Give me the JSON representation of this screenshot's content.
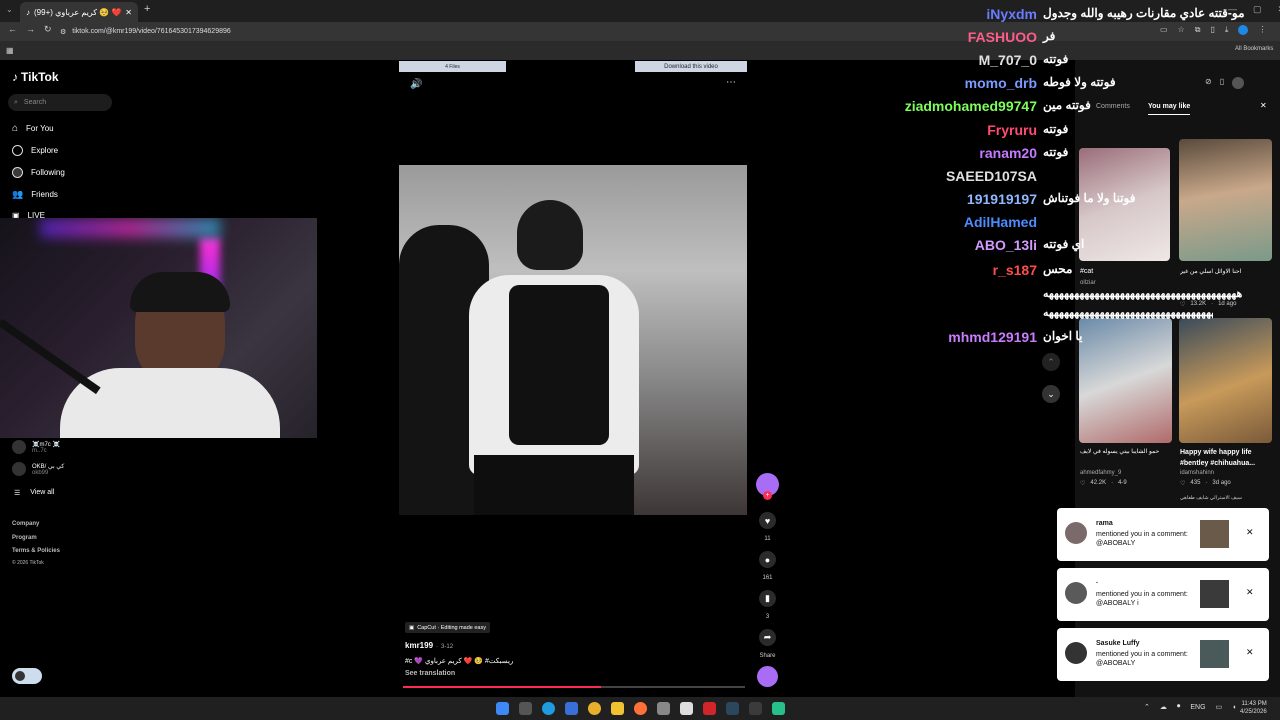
{
  "browser": {
    "tab_title": "(99+) كريم عرباوي 🥺 ❤️ R...",
    "url": "tiktok.com/@kmr199/video/7616453017394629896",
    "bookmarks_label": "All Bookmarks"
  },
  "sidebar": {
    "logo": "TikTok",
    "search_placeholder": "Search",
    "items": [
      {
        "label": "For You"
      },
      {
        "label": "Explore"
      },
      {
        "label": "Following"
      },
      {
        "label": "Friends"
      },
      {
        "label": "LIVE"
      }
    ],
    "accounts": [
      {
        "name": "☠️m7c ☠️",
        "handle": "m..7c"
      },
      {
        "name": "OKB/ كي بي",
        "handle": "okb99"
      }
    ],
    "view_all": "View all",
    "footer": [
      "Company",
      "Program",
      "Terms & Policies",
      "© 2026 TikTok"
    ]
  },
  "player": {
    "overlay_left": "4 Files",
    "overlay_right": "Download this video",
    "capcut": "CapCut · Editing made easy",
    "author": "kmr199",
    "date": "3-12",
    "caption": "#c 💜 ريسبكت# 🥺 ❤️ كريم عرباوي",
    "see_translation": "See translation",
    "likes": "11",
    "comments": "161",
    "saves": "3",
    "share": "Share",
    "progress": 0.58
  },
  "chat": [
    {
      "name": "iNyxdm",
      "msg": "مو-قتته عادي مقارنات رهيبه والله وجدول",
      "color": "#6a7cff"
    },
    {
      "name": "FASHUOO",
      "msg": "فر",
      "color": "#ff5c8a"
    },
    {
      "name": "M_707_0",
      "msg": "فوتته",
      "color": "#e0e0e0"
    },
    {
      "name": "momo_drb",
      "msg": "فوتته ولا فوطه",
      "color": "#7a9cff"
    },
    {
      "name": "ziadmohamed99747",
      "msg": "فوتته مين",
      "color": "#7dff5a"
    },
    {
      "name": "Fryruru",
      "msg": "فوتته",
      "color": "#ff4d6d"
    },
    {
      "name": "ranam20",
      "msg": "فوتته",
      "color": "#c67bff"
    },
    {
      "name": "SAEED107SA",
      "msg": "",
      "color": "#e0e0e0"
    },
    {
      "name": "191919197",
      "msg": "فوتنا ولا ما فوتناش",
      "color": "#8fb8ff"
    },
    {
      "name": "AdilHamed",
      "msg": "",
      "color": "#4d8cff"
    },
    {
      "name": "ABO_13li",
      "msg": "اي فوتته",
      "color": "#d49aff"
    },
    {
      "name": "r_s187",
      "msg": "محس",
      "color": "#ff4d4d"
    },
    {
      "name": "mhmd129191",
      "msg": "يا اخوان",
      "color": "#c87cff"
    }
  ],
  "chat_spam": "ههههههههههههههههههههههههههههههههههههههه",
  "right_panel": {
    "tabs": [
      "Comments",
      "You may like"
    ],
    "cards": [
      {
        "title": "#cat",
        "author": "ollziar",
        "likes": "",
        "date": ""
      },
      {
        "title": "احنا الاوائل اسلي من غير",
        "author": "",
        "likes": "13.2K",
        "date": "1d ago"
      },
      {
        "title": "حمو الشايبا بيتي يسوله في لايف",
        "author": "ahmedfahmy_9",
        "likes": "42.2K",
        "date": "4-9"
      },
      {
        "title": "Happy wife happy life #bentley #chihuahua...",
        "author": "idamshahinn",
        "likes": "435",
        "date": "3d ago"
      }
    ],
    "extra_caption": "سيف الاسترالي شايف طفاهي"
  },
  "notifications": [
    {
      "user": "rama",
      "text": "mentioned you in a comment: @ABOBALY"
    },
    {
      "user": ".",
      "text": "mentioned you in a comment: @ABOBALY i"
    },
    {
      "user": "Sasuke Luffy",
      "text": "mentioned you in a comment: @ABOBALY"
    }
  ],
  "taskbar": {
    "lang": "ENG",
    "time": "11:43 PM",
    "date": "4/25/2026"
  },
  "colors": {
    "accent": "#fe2c55",
    "purple": "#a86cf5"
  }
}
